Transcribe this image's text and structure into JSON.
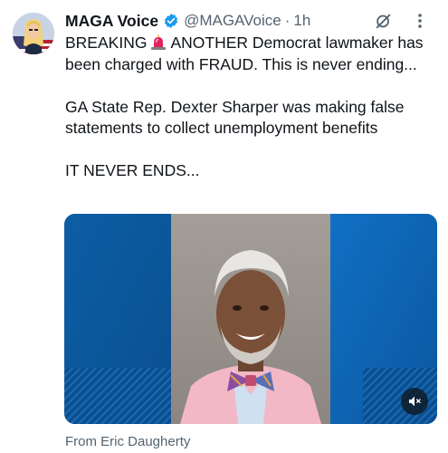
{
  "author": {
    "name": "MAGA Voice",
    "handle": "@MAGAVoice",
    "separator": "·",
    "time": "1h"
  },
  "icons": {
    "verified": "verified-badge-icon",
    "grok": "grok-icon",
    "more": "more-options-icon",
    "siren": "siren-emoji-icon",
    "mute": "volume-muted-icon"
  },
  "tweet": {
    "line1_prefix": "BREAKING",
    "line1_rest": "ANOTHER Democrat lawmaker has been charged with FRAUD. This is never ending...",
    "paragraph2": "GA State Rep. Dexter Sharper was making false statements to collect unemployment benefits",
    "paragraph3": "IT NEVER ENDS..."
  },
  "media": {
    "attribution": "From Eric Daugherty"
  },
  "colors": {
    "verified_blue": "#1d9bf0",
    "text_primary": "#0f1419",
    "text_secondary": "#536471",
    "media_blue": "#0f5fa8"
  }
}
